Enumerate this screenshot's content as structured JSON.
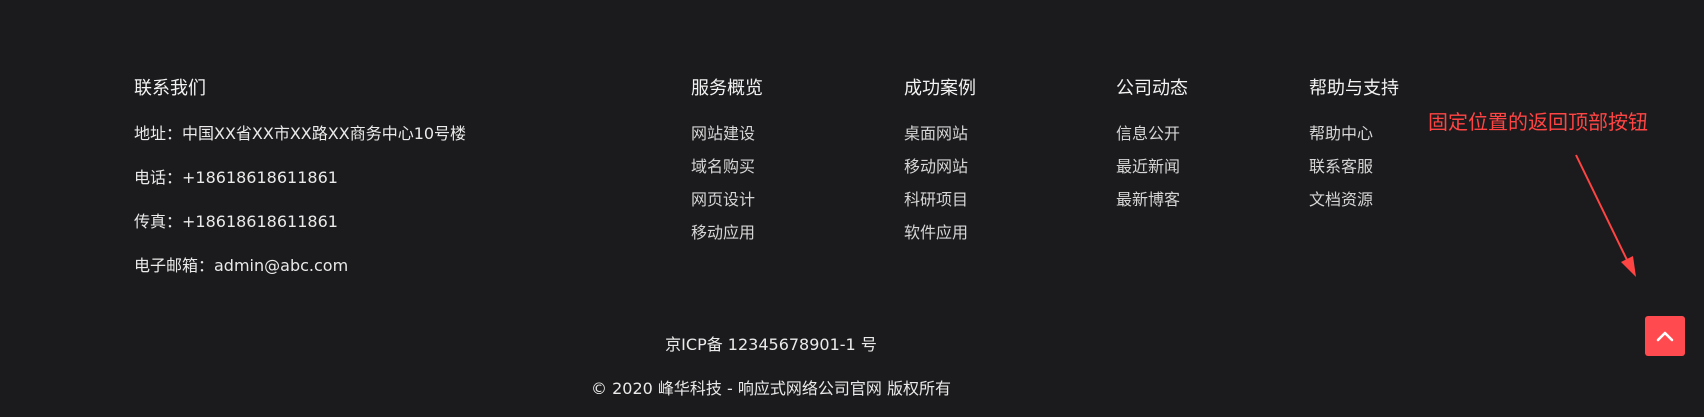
{
  "contact": {
    "title": "联系我们",
    "address": "地址：中国XX省XX市XX路XX商务中心10号楼",
    "phone": "电话：+18618618611861",
    "fax": "传真：+18618618611861",
    "email": "电子邮箱：admin@abc.com"
  },
  "columns": [
    {
      "title": "服务概览",
      "links": [
        "网站建设",
        "域名购买",
        "网页设计",
        "移动应用"
      ]
    },
    {
      "title": "成功案例",
      "links": [
        "桌面网站",
        "移动网站",
        "科研项目",
        "软件应用"
      ]
    },
    {
      "title": "公司动态",
      "links": [
        "信息公开",
        "最近新闻",
        "最新博客"
      ]
    },
    {
      "title": "帮助与支持",
      "links": [
        "帮助中心",
        "联系客服",
        "文档资源"
      ]
    }
  ],
  "footer": {
    "icp": "京ICP备 12345678901-1 号",
    "copyright": "© 2020 峰华科技 - 响应式网络公司官网 版权所有"
  },
  "annotation": {
    "text": "固定位置的返回顶部按钮",
    "color": "#ff4444"
  },
  "back_to_top": {
    "icon": "chevron-up-icon",
    "color": "#ff4a4f"
  }
}
